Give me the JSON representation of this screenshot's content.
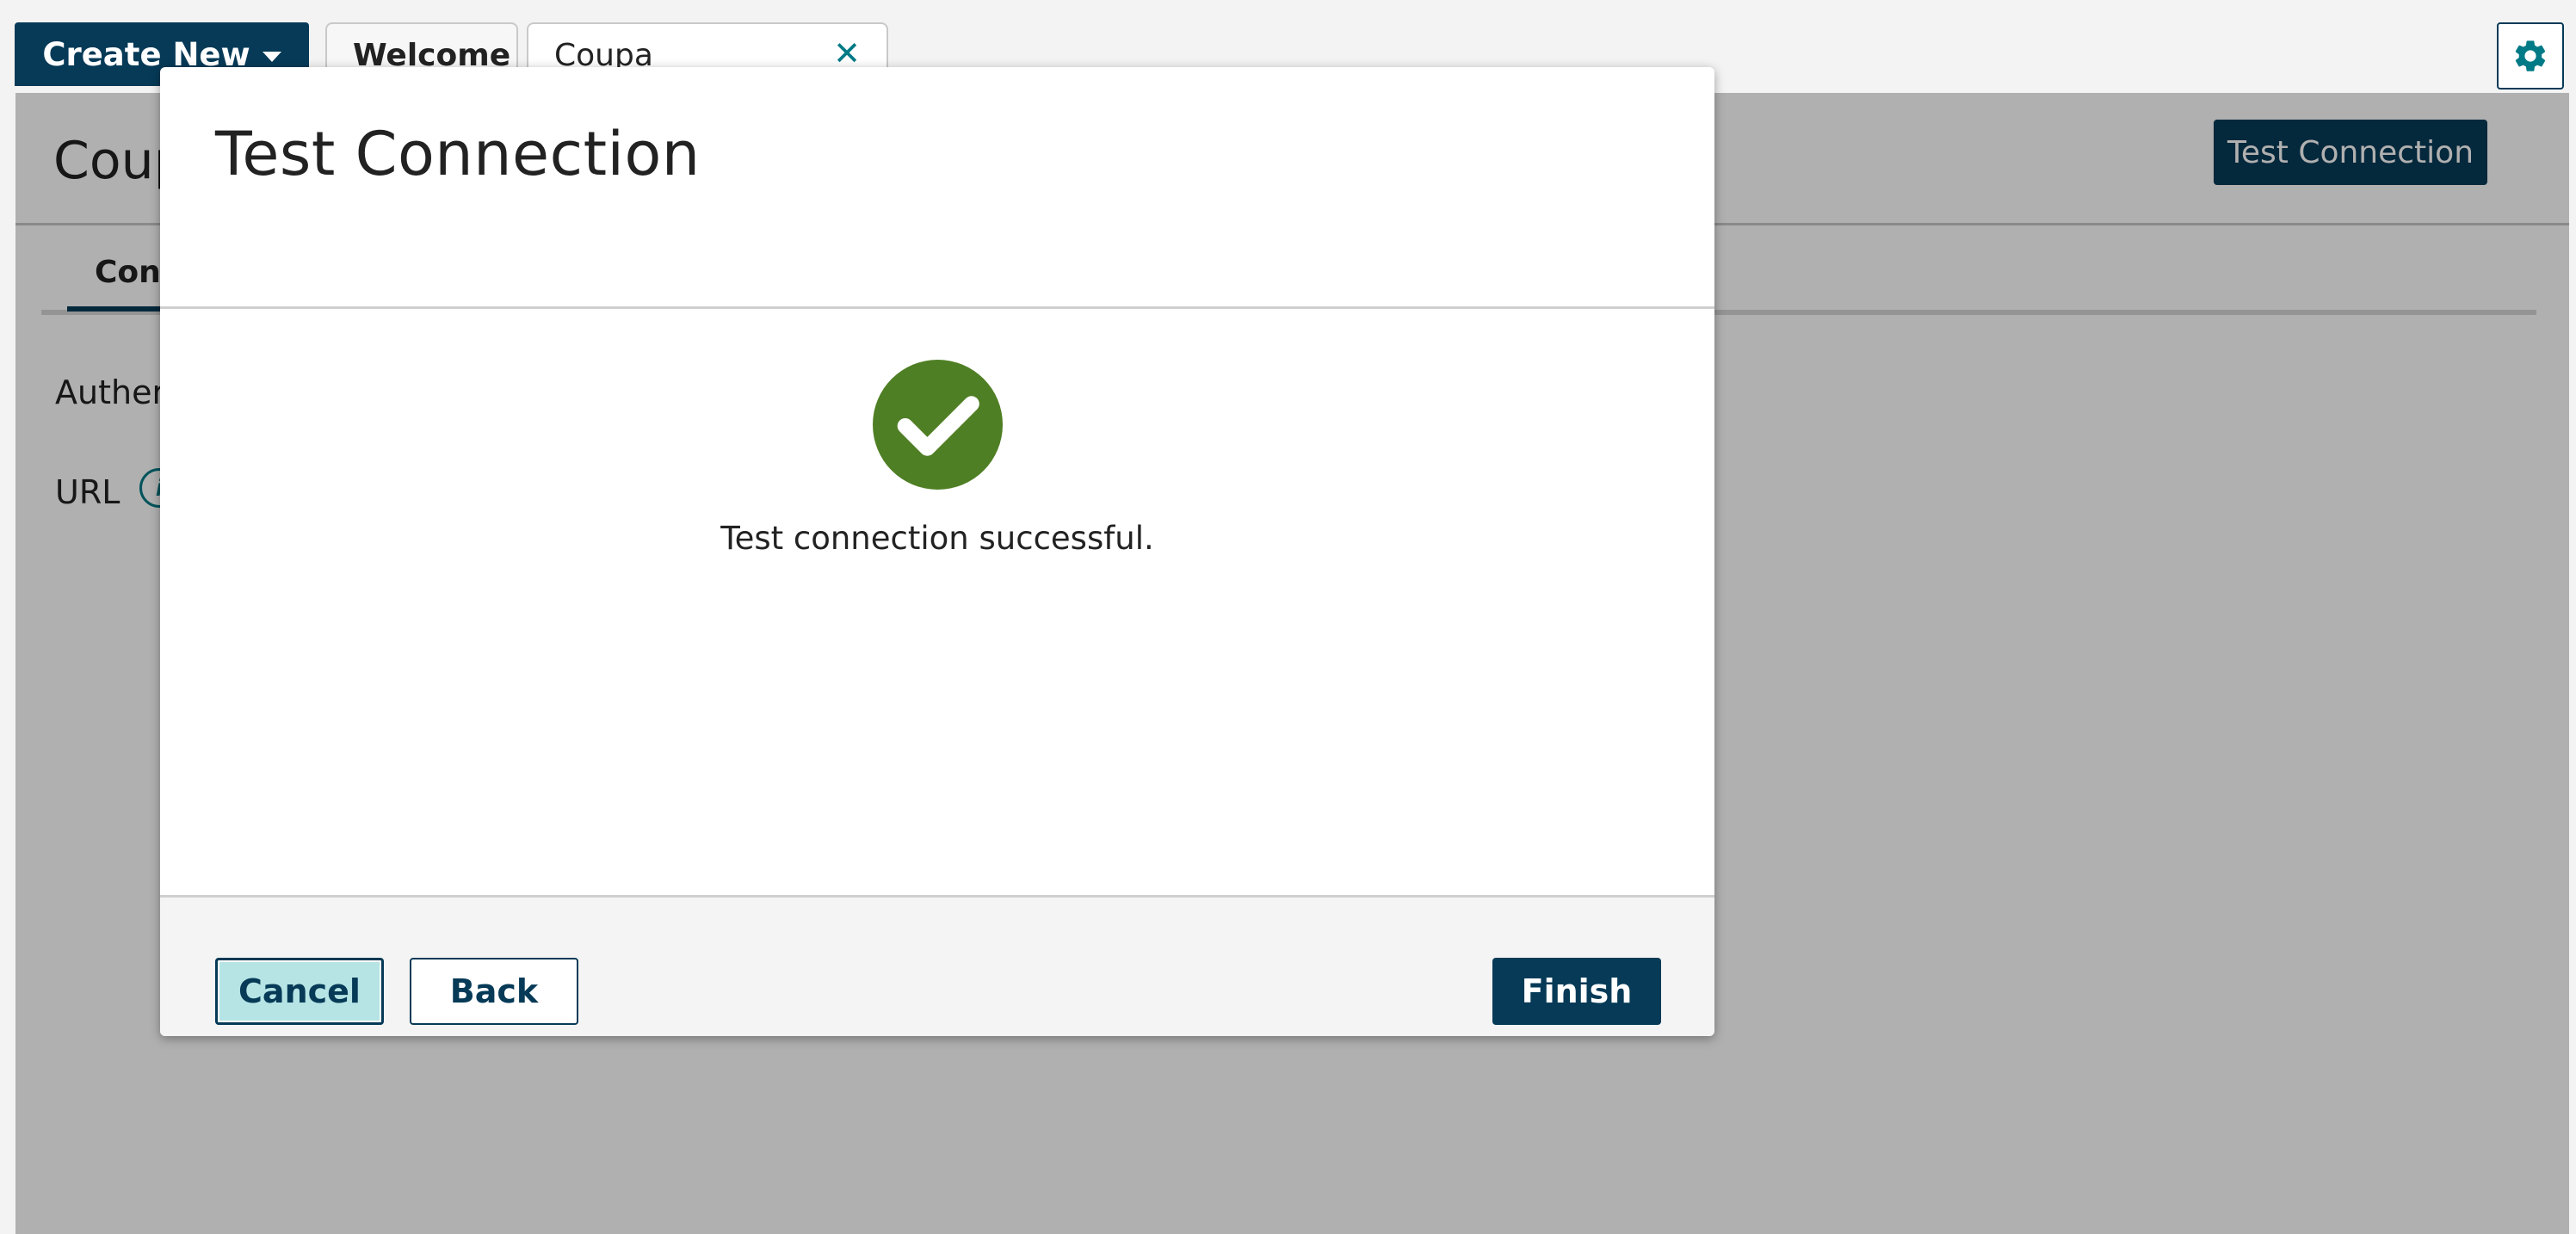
{
  "topbar": {
    "create_new_label": "Create New",
    "tabs": [
      {
        "label": "Welcome"
      },
      {
        "label": "Coupa Connection"
      }
    ]
  },
  "workspace": {
    "title": "Coup",
    "test_connection_label": "Test Connection",
    "tab_label": "Con",
    "field_authentication": "Auther",
    "field_url": "URL",
    "info_glyph": "i"
  },
  "dialog": {
    "title": "Test Connection",
    "message": "Test connection successful.",
    "buttons": {
      "cancel": "Cancel",
      "back": "Back",
      "finish": "Finish"
    }
  },
  "colors": {
    "brand": "#063a57",
    "accent": "#007a86",
    "success": "#4f7f24",
    "cancel_focus_bg": "#b6e4e4"
  },
  "icons": {
    "gear": "gear-icon",
    "close": "close-icon",
    "success": "checkmark-circle-icon",
    "dropdown": "caret-down-icon",
    "info": "info-icon"
  }
}
